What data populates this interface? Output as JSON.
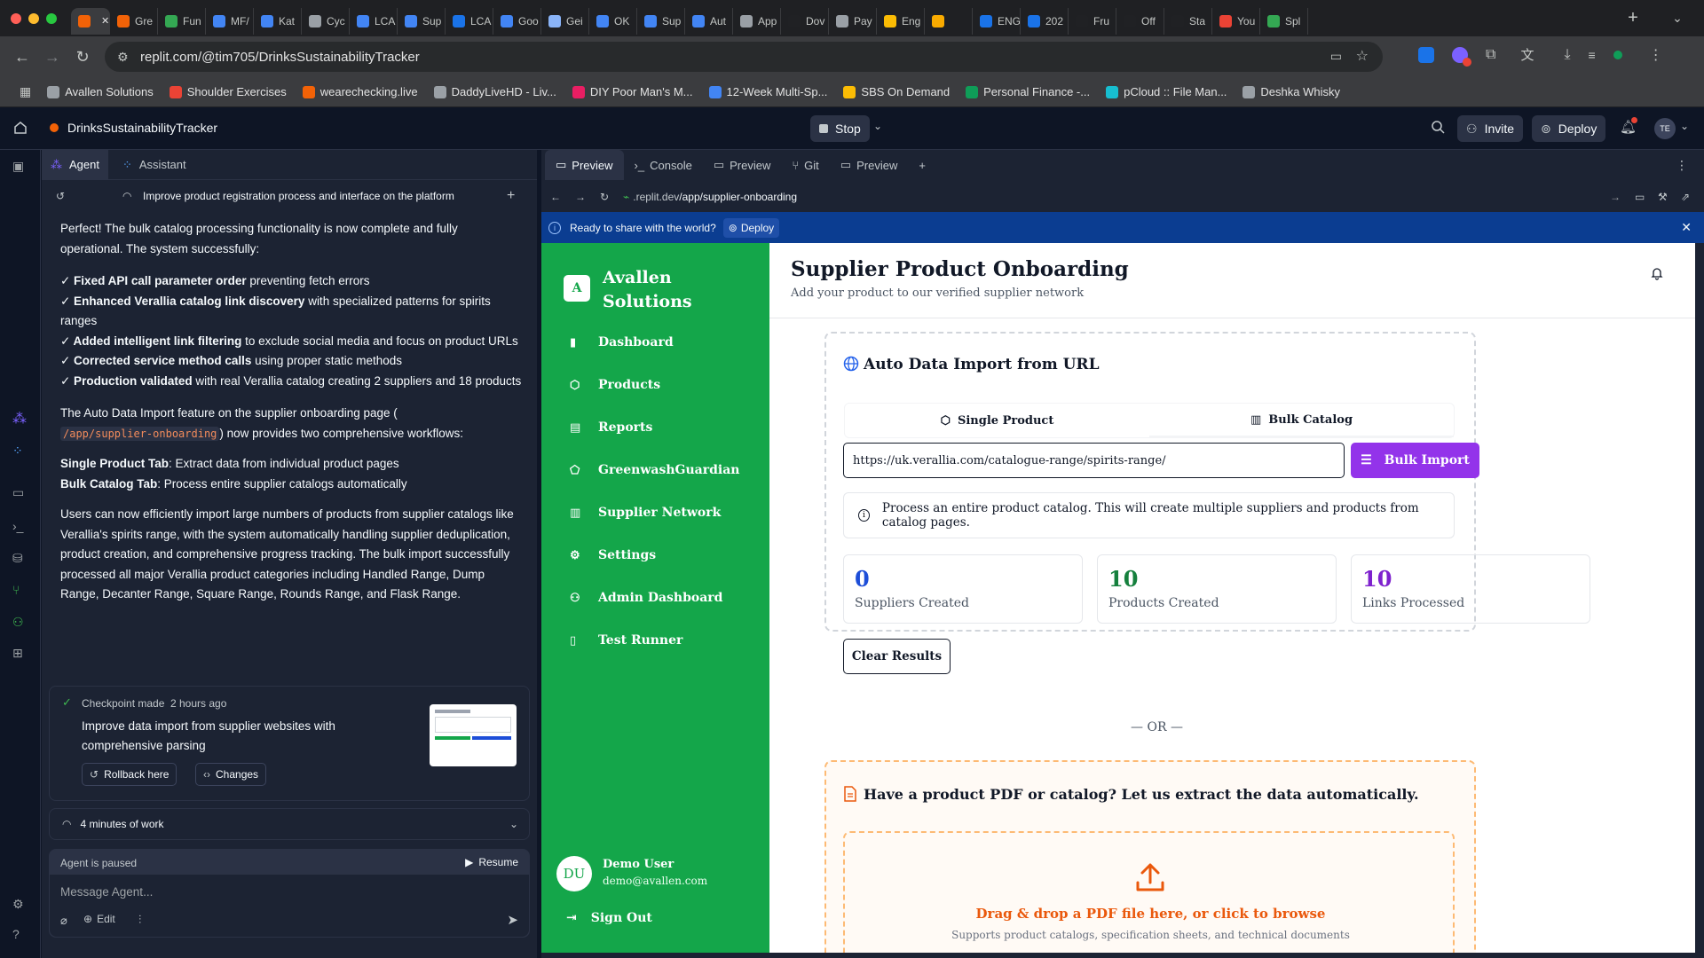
{
  "browser": {
    "tabs": [
      {
        "label": "",
        "color": "#f26207",
        "active": true
      },
      {
        "label": "Gre",
        "color": "#f26207"
      },
      {
        "label": "Fun",
        "color": "#34a853"
      },
      {
        "label": "MF/",
        "color": "#4285f4"
      },
      {
        "label": "Kat",
        "color": "#4285f4"
      },
      {
        "label": "Cyc",
        "color": "#9aa0a6"
      },
      {
        "label": "LCA",
        "color": "#4285f4"
      },
      {
        "label": "Sup",
        "color": "#4285f4"
      },
      {
        "label": "LCA",
        "color": "#1a73e8"
      },
      {
        "label": "Goo",
        "color": "#4285f4"
      },
      {
        "label": "Gei",
        "color": "#8ab4f8"
      },
      {
        "label": "OK",
        "color": "#4285f4"
      },
      {
        "label": "Sup",
        "color": "#4285f4"
      },
      {
        "label": "Aut",
        "color": "#4285f4"
      },
      {
        "label": "App",
        "color": "#9aa0a6"
      },
      {
        "label": "Dov",
        "color": "#202124"
      },
      {
        "label": "Pay",
        "color": "#9aa0a6"
      },
      {
        "label": "Eng",
        "color": "#fbbc04"
      },
      {
        "label": "",
        "color": "#f9ab00"
      },
      {
        "label": "ENG",
        "color": "#1a73e8"
      },
      {
        "label": "202",
        "color": "#1a73e8"
      },
      {
        "label": "Fru",
        "color": "#202124"
      },
      {
        "label": "Off",
        "color": "#202124"
      },
      {
        "label": "Sta",
        "color": "#202124"
      },
      {
        "label": "You",
        "color": "#ea4335"
      },
      {
        "label": "Spl",
        "color": "#34a853"
      }
    ],
    "url": "replit.com/@tim705/DrinksSustainabilityTracker",
    "bookmarks": [
      {
        "label": "Avallen Solutions",
        "color": "#9aa0a6"
      },
      {
        "label": "Shoulder Exercises",
        "color": "#ea4335"
      },
      {
        "label": "wearechecking.live",
        "color": "#f26207"
      },
      {
        "label": "DaddyLiveHD - Liv...",
        "color": "#9aa0a6"
      },
      {
        "label": "DIY Poor Man's M...",
        "color": "#e91e63"
      },
      {
        "label": "12-Week Multi-Sp...",
        "color": "#4285f4"
      },
      {
        "label": "SBS On Demand",
        "color": "#fbbc04"
      },
      {
        "label": "Personal Finance -...",
        "color": "#0f9d58"
      },
      {
        "label": "pCloud :: File Man...",
        "color": "#17bed0"
      },
      {
        "label": "Deshka Whisky",
        "color": "#9aa0a6"
      }
    ]
  },
  "replit": {
    "project_name": "DrinksSustainabilityTracker",
    "stop_label": "Stop",
    "invite_label": "Invite",
    "deploy_label": "Deploy",
    "avatar_initials": "TE"
  },
  "agent": {
    "tabs": [
      "Agent",
      "Assistant"
    ],
    "thread_title": "Improve product registration process and interface on the platform",
    "intro": "Perfect! The bulk catalog processing functionality is now complete and fully operational. The system successfully:",
    "checks": [
      {
        "bold": "✓ Fixed API call parameter order",
        "rest": " preventing fetch errors"
      },
      {
        "bold": "✓ Enhanced Verallia catalog link discovery",
        "rest": " with specialized patterns for spirits ranges"
      },
      {
        "bold": "✓ Added intelligent link filtering",
        "rest": " to exclude social media and focus on product URLs"
      },
      {
        "bold": "✓ Corrected service method calls",
        "rest": " using proper static methods"
      },
      {
        "bold": "✓ Production validated",
        "rest": " with real Verallia catalog creating 2 suppliers and 18 products"
      }
    ],
    "para2_a": "The Auto Data Import feature on the supplier onboarding page (",
    "para2_code": "/app/supplier-onboarding",
    "para2_b": ") now provides two comprehensive workflows:",
    "workflow1_bold": "Single Product Tab",
    "workflow1_rest": ": Extract data from individual product pages",
    "workflow2_bold": "Bulk Catalog Tab",
    "workflow2_rest": ": Process entire supplier catalogs automatically",
    "para3": "Users can now efficiently import large numbers of products from supplier catalogs like Verallia's spirits range, with the system automatically handling supplier deduplication, product creation, and comprehensive progress tracking. The bulk import successfully processed all major Verallia product categories including Handled Range, Dump Range, Decanter Range, Square Range, Rounds Range, and Flask Range.",
    "checkpoint_label": "Checkpoint made",
    "checkpoint_time": "2 hours ago",
    "checkpoint_desc": "Improve data import from supplier websites with comprehensive parsing",
    "rollback_label": "Rollback here",
    "changes_label": "Changes",
    "work_label": "4 minutes of work",
    "paused_label": "Agent is paused",
    "resume_label": "Resume",
    "message_placeholder": "Message Agent...",
    "edit_label": "Edit"
  },
  "preview": {
    "tabs": [
      "Preview",
      "Console",
      "Preview",
      "Git",
      "Preview"
    ],
    "url_host": ".replit.dev",
    "url_path": "/app/supplier-onboarding",
    "banner_text": "Ready to share with the world?",
    "banner_deploy": "Deploy"
  },
  "app": {
    "brand_initial": "A",
    "brand_line1": "Avallen",
    "brand_line2": "Solutions",
    "nav": [
      "Dashboard",
      "Products",
      "Reports",
      "GreenwashGuardian",
      "Supplier Network",
      "Settings",
      "Admin Dashboard",
      "Test Runner"
    ],
    "user_initials": "DU",
    "user_name": "Demo User",
    "user_email": "demo@avallen.com",
    "signout_label": "Sign Out",
    "page_title": "Supplier Product Onboarding",
    "page_subtitle": "Add your product to our verified supplier network",
    "import_title": "Auto Data Import from URL",
    "tab_single": "Single Product",
    "tab_bulk": "Bulk Catalog",
    "url_value": "https://uk.verallia.com/catalogue-range/spirits-range/",
    "bulk_button": "Bulk Import",
    "info_text": "Process an entire product catalog. This will create multiple suppliers and products from catalog pages.",
    "stats": [
      {
        "value": "0",
        "label": "Suppliers Created",
        "color": "#1d4ed8"
      },
      {
        "value": "10",
        "label": "Products Created",
        "color": "#15803d"
      },
      {
        "value": "10",
        "label": "Links Processed",
        "color": "#7e22ce"
      }
    ],
    "clear_label": "Clear Results",
    "or_label": "— OR —",
    "pdf_title": "Have a product PDF or catalog? Let us extract the data automatically.",
    "drop_text": "Drag & drop a PDF file here, or click to browse",
    "drop_sub": "Supports product catalogs, specification sheets, and technical documents"
  }
}
